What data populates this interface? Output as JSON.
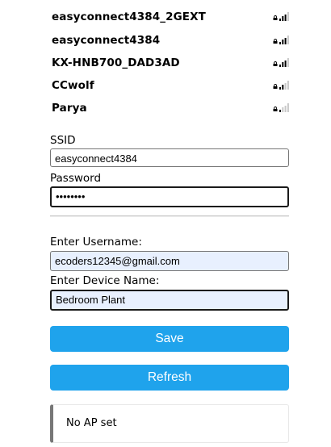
{
  "networks": [
    {
      "name": "easyconnect4384_2GEXT",
      "secured": true,
      "signal_bars": 3
    },
    {
      "name": "easyconnect4384",
      "secured": true,
      "signal_bars": 3
    },
    {
      "name": "KX-HNB700_DAD3AD",
      "secured": true,
      "signal_bars": 3
    },
    {
      "name": "CCwolf",
      "secured": true,
      "signal_bars": 2
    },
    {
      "name": "Parya",
      "secured": true,
      "signal_bars": 1
    }
  ],
  "form": {
    "ssid_label": "SSID",
    "ssid_value": "easyconnect4384",
    "password_label": "Password",
    "password_value": "••••••••",
    "username_label": "Enter Username:",
    "username_value": "ecoders12345@gmail.com",
    "device_label": "Enter Device Name:",
    "device_value": "Bedroom Plant"
  },
  "buttons": {
    "save_label": "Save",
    "refresh_label": "Refresh"
  },
  "status": {
    "message": "No AP set"
  },
  "colors": {
    "button": "#1fa3ec",
    "autofill_background": "#e8f0fe",
    "signal_active": "#000000",
    "signal_inactive": "#c8c8c8"
  },
  "icons": {
    "lock": "lock-icon",
    "signal": "wifi-signal-icon"
  }
}
